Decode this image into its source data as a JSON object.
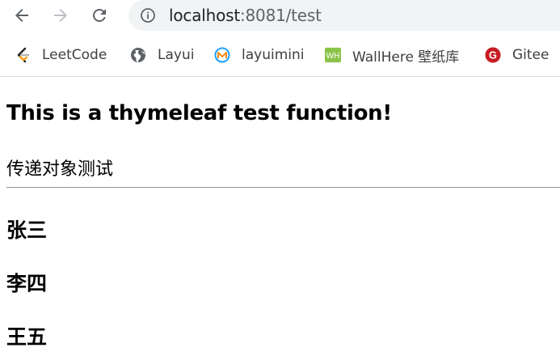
{
  "browser": {
    "url_host": "localhost",
    "url_rest": ":8081/test",
    "bookmarks": [
      {
        "label": "LeetCode",
        "icon": "leetcode-icon"
      },
      {
        "label": "Layui",
        "icon": "globe-icon"
      },
      {
        "label": "layuimini",
        "icon": "layuimini-icon"
      },
      {
        "label": "WallHere 壁纸库",
        "icon": "wallhere-icon",
        "icon_text": "WH"
      },
      {
        "label": "Gitee",
        "icon": "gitee-icon",
        "icon_text": "G"
      }
    ]
  },
  "page": {
    "heading": "This is a thymeleaf test function!",
    "subtitle": "传递对象测试",
    "names": [
      "张三",
      "李四",
      "王五"
    ]
  },
  "colors": {
    "toolbar_icon": "#5f6368",
    "omnibox_bg": "#f1f3f4",
    "leetcode_orange": "#ffa116",
    "wallhere_green": "#8bc34a",
    "gitee_red": "#c71d23",
    "layuimini_blue": "#1e9fff"
  }
}
